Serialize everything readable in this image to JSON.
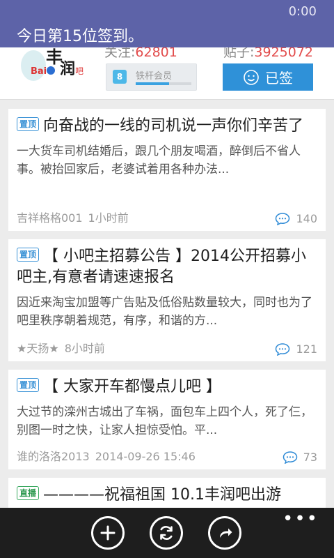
{
  "notification": {
    "time": "0:00",
    "message": "今日第15位签到。"
  },
  "forum": {
    "logo_text": "Bai 丰润 吧",
    "follow_label": "关注:",
    "follow_count": "62801",
    "posts_label": "贴子:",
    "posts_count": "3925072",
    "member_level": "8",
    "member_title": "铁杆会员",
    "member_progress": 0.6,
    "sign_label": "已签"
  },
  "posts": [
    {
      "tag": "置顶",
      "title": "向奋战的一线的司机说一声你们辛苦了",
      "excerpt": "一大货车司机结婚后，跟几个朋友喝酒，醉倒后不省人事。被抬回家后，老婆试着用各种办法...",
      "author": "吉祥格格001",
      "time": "1小时前",
      "replies": "140"
    },
    {
      "tag": "置顶",
      "title": "【 小吧主招募公告 】2014公开招募小吧主,有意者请速速报名",
      "excerpt": "因近来淘宝加盟等广告贴及低俗贴数量较大，同时也为了吧里秩序朝着规范，有序，和谐的方...",
      "author": "★天扬★",
      "time": "8小时前",
      "replies": "121"
    },
    {
      "tag": "置顶",
      "title": "【 大家开车都慢点儿吧 】",
      "excerpt": "大过节的滦州古城出了车祸，面包车上四个人，死了仨，别图一时之快，让家人担惊受怕。平...",
      "author": "谁的洛洛2013",
      "time": "2014-09-26 15:46",
      "replies": "73"
    },
    {
      "tag": "直播",
      "title": "————祝福祖国  10.1丰润吧出游"
    }
  ],
  "appbar": {
    "more": "•••"
  },
  "colors": {
    "banner": "#5d63a8",
    "accent": "#2f91d8",
    "stat": "#e24c4c"
  }
}
